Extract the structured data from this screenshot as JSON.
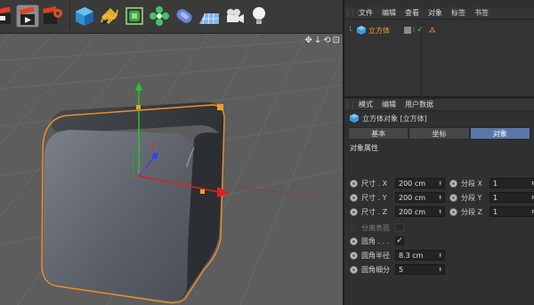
{
  "object_manager": {
    "menu": [
      "文件",
      "编辑",
      "查看",
      "对象",
      "标签",
      "书签"
    ],
    "object_name": "立方体"
  },
  "attribute_manager": {
    "menu": [
      "模式",
      "编辑",
      "用户数据"
    ],
    "title": "立方体对象 [立方体]",
    "tabs": [
      "基本",
      "坐标",
      "对象"
    ],
    "active_tab": "对象",
    "section": "对象属性",
    "size_x_label": "尺寸 . X",
    "size_x": "200 cm",
    "size_y_label": "尺寸 . Y",
    "size_y": "200 cm",
    "size_z_label": "尺寸 . Z",
    "size_z": "200 cm",
    "seg_x_label": "分段 X",
    "seg_x": "1",
    "seg_y_label": "分段 Y",
    "seg_y": "1",
    "seg_z_label": "分段 Z",
    "seg_z": "1",
    "separate_label": "分离表面",
    "fillet_label": "圆角 . . .",
    "fillet_checked": "✓",
    "fillet_radius_label": "圆角半径",
    "fillet_radius": "8.3 cm",
    "fillet_subdiv_label": "圆角细分",
    "fillet_subdiv": "5"
  },
  "viewport": {
    "nav_icons": [
      "move-view-icon",
      "dolly-icon",
      "rotate-view-icon",
      "maximize-icon"
    ]
  },
  "colors": {
    "selection": "#f0902a",
    "axis_x": "#e02020",
    "axis_y": "#30c030",
    "axis_z": "#2050e0",
    "active_tab": "#5a77a8"
  }
}
